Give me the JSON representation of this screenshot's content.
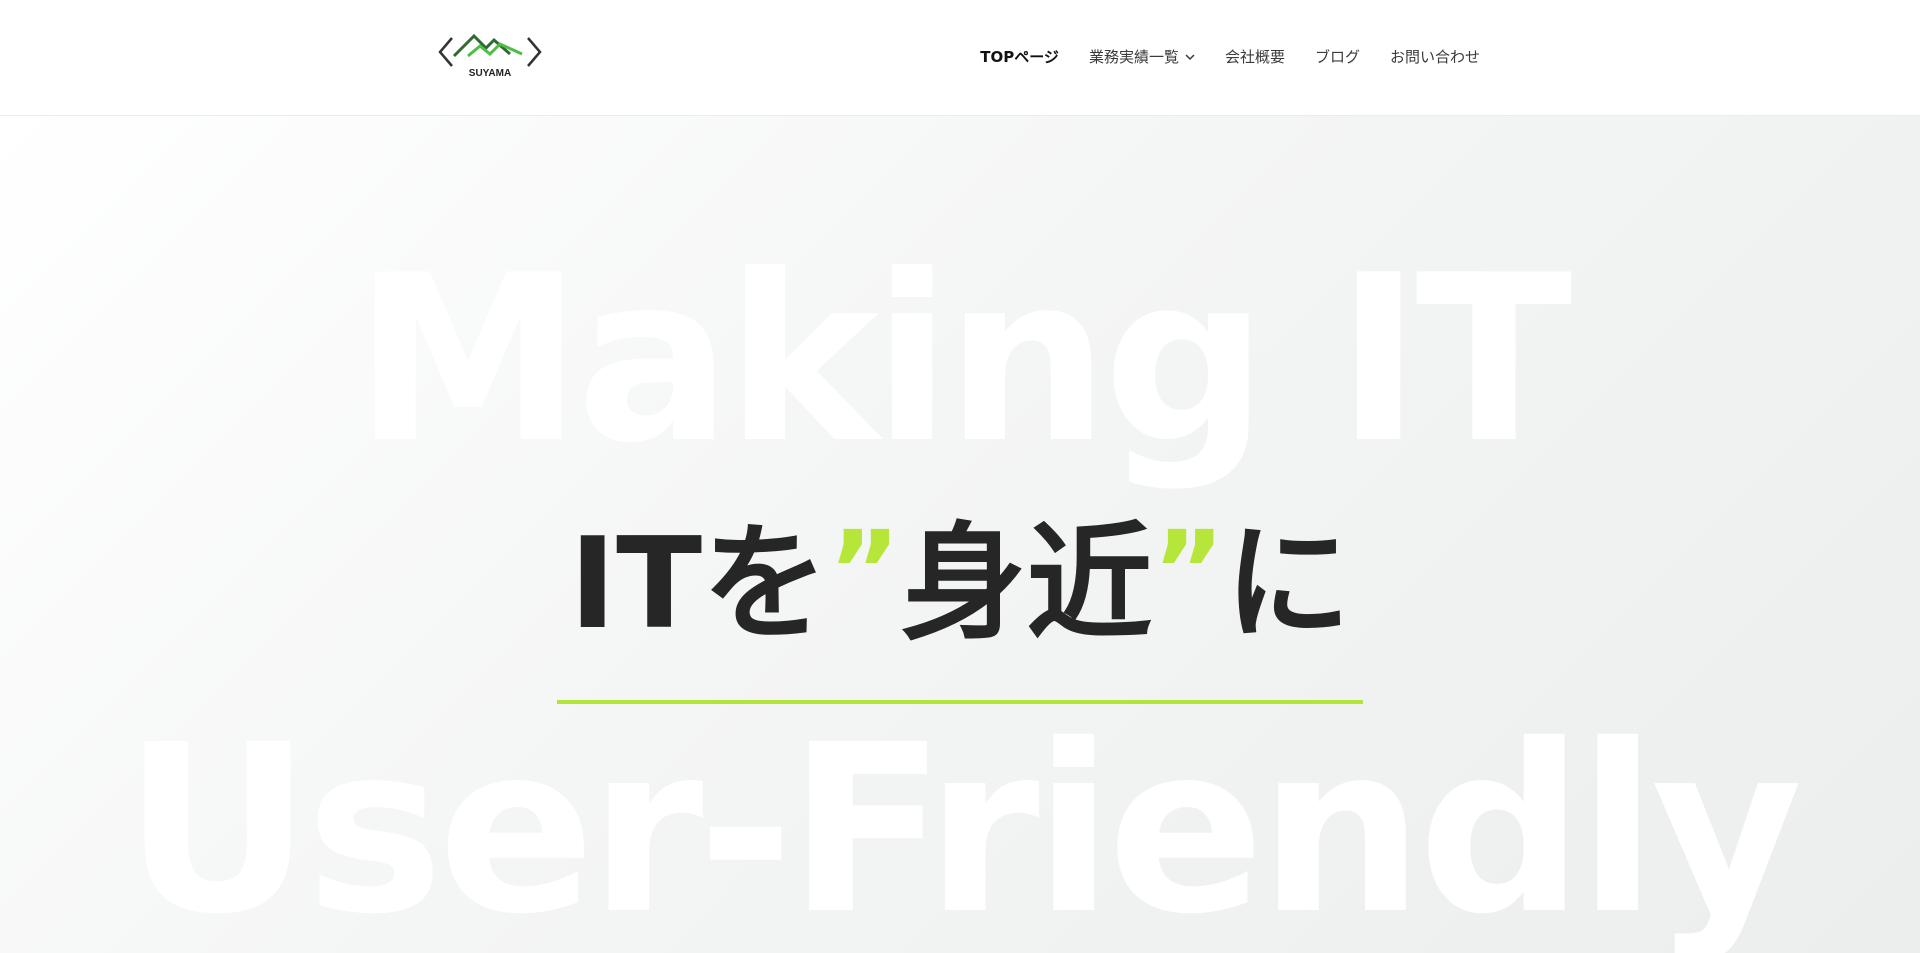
{
  "header": {
    "logo_text": "SUYAMA",
    "nav": [
      {
        "label": "TOPページ",
        "active": true,
        "has_dropdown": false
      },
      {
        "label": "業務実績一覧",
        "active": false,
        "has_dropdown": true
      },
      {
        "label": "会社概要",
        "active": false,
        "has_dropdown": false
      },
      {
        "label": "ブログ",
        "active": false,
        "has_dropdown": false
      },
      {
        "label": "お問い合わせ",
        "active": false,
        "has_dropdown": false
      }
    ]
  },
  "hero": {
    "bg_top": "Making IT",
    "bg_bottom": "User-Friendly",
    "headline": {
      "part1": "ITを",
      "quote_open": "”",
      "part2": "身近",
      "quote_close": "”",
      "part3": "に"
    }
  },
  "colors": {
    "accent": "#b3e43a",
    "text_dark": "#262626",
    "logo_dark_green": "#2f6b2f",
    "logo_light_green": "#4cc043"
  }
}
